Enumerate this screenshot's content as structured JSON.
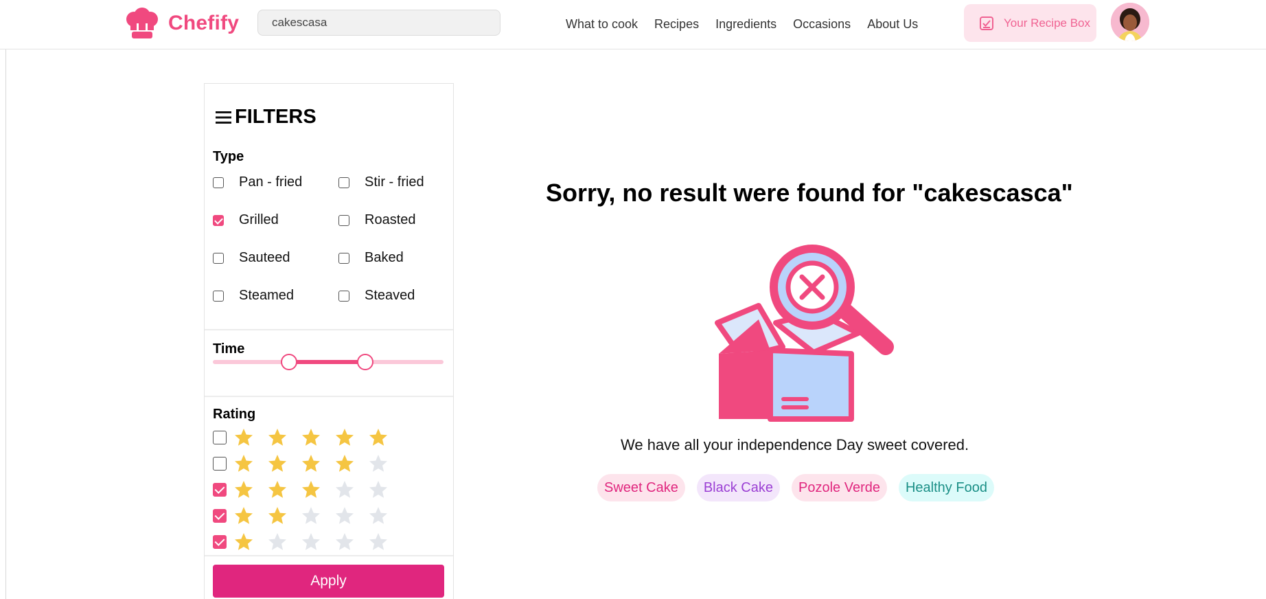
{
  "header": {
    "brand": "Chefify",
    "search": {
      "value": "cakescasa",
      "placeholder": ""
    },
    "nav": [
      "What to cook",
      "Recipes",
      "Ingredients",
      "Occasions",
      "About Us"
    ],
    "recipe_box_label": "Your Recipe Box"
  },
  "filters": {
    "title": "FILTERS",
    "type_label": "Type",
    "types": [
      {
        "label": "Pan - fried",
        "checked": false
      },
      {
        "label": "Stir - fried",
        "checked": false
      },
      {
        "label": "Grilled",
        "checked": true
      },
      {
        "label": "Roasted",
        "checked": false
      },
      {
        "label": "Sauteed",
        "checked": false
      },
      {
        "label": "Baked",
        "checked": false
      },
      {
        "label": "Steamed",
        "checked": false
      },
      {
        "label": "Steaved",
        "checked": false
      }
    ],
    "time_label": "Time",
    "time_range": {
      "low_fraction": 0.33,
      "high_fraction": 0.66
    },
    "rating_label": "Rating",
    "ratings": [
      {
        "stars": 5,
        "checked": false
      },
      {
        "stars": 4,
        "checked": false
      },
      {
        "stars": 3,
        "checked": true
      },
      {
        "stars": 2,
        "checked": true
      },
      {
        "stars": 1,
        "checked": true
      }
    ],
    "apply_label": "Apply"
  },
  "main": {
    "title": "Sorry, no result were found for \"cakescasca\"",
    "subtext": "We have all your independence Day sweet covered.",
    "tags": [
      {
        "label": "Sweet Cake",
        "bg": "#fde4ec",
        "color": "#e0267e"
      },
      {
        "label": "Black Cake",
        "bg": "#f3e6fb",
        "color": "#9b3fd4"
      },
      {
        "label": "Pozole Verde",
        "bg": "#fde4ec",
        "color": "#e0267e"
      },
      {
        "label": "Healthy Food",
        "bg": "#dcfbfa",
        "color": "#1a8f86"
      }
    ]
  },
  "colors": {
    "brand": "#f0497f",
    "accent": "#e0267e",
    "star": "#f5c542",
    "star_empty": "#e2e5ea"
  }
}
